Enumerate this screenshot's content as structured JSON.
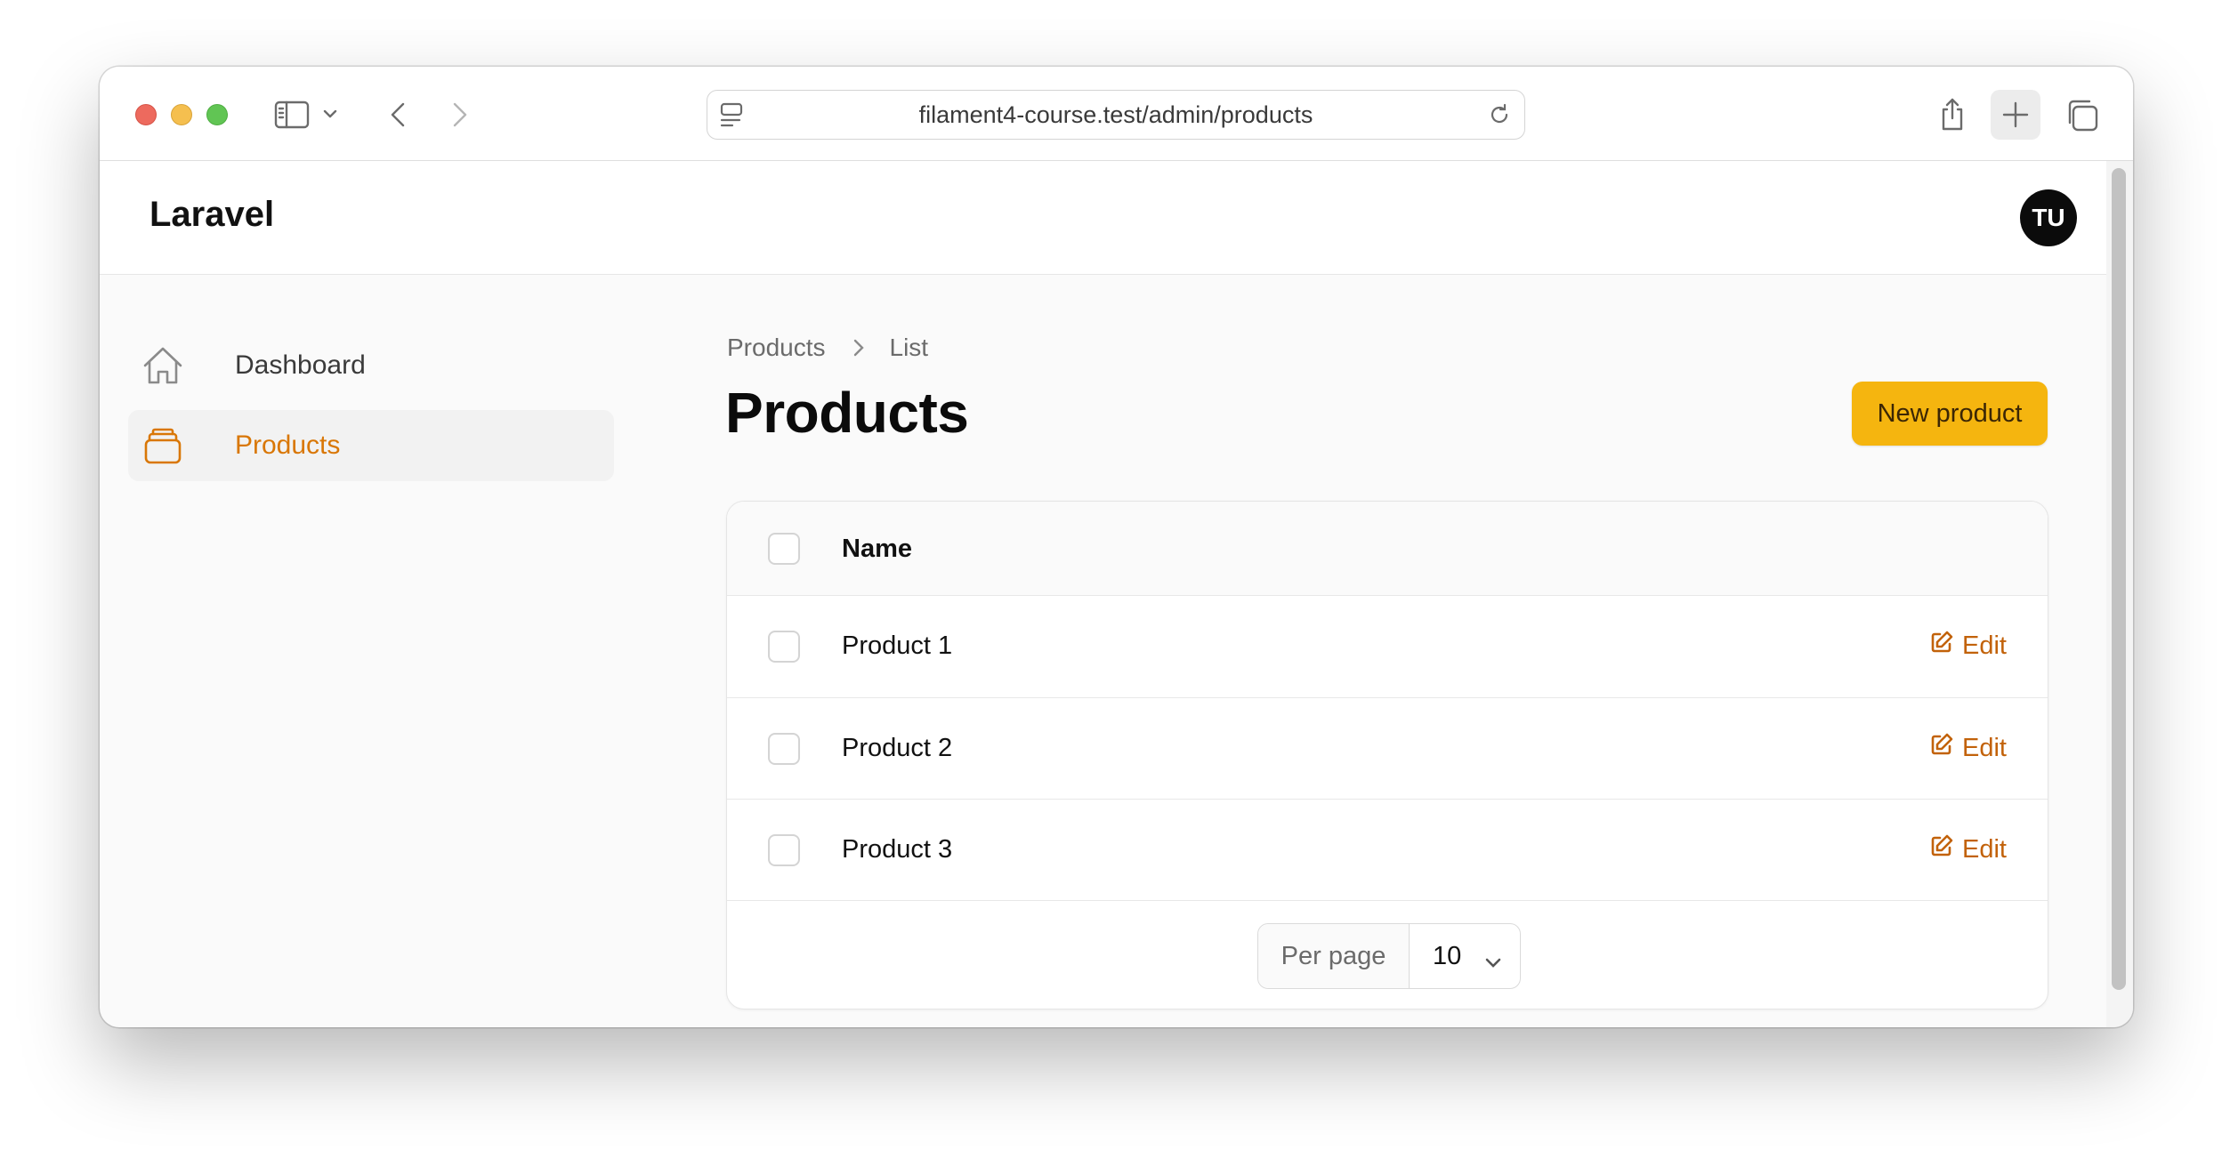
{
  "browser": {
    "url": "filament4-course.test/admin/products"
  },
  "app": {
    "brand": "Laravel",
    "user_initials": "TU"
  },
  "sidebar": {
    "items": [
      {
        "label": "Dashboard",
        "icon": "home-icon",
        "active": false
      },
      {
        "label": "Products",
        "icon": "archive-box-icon",
        "active": true
      }
    ]
  },
  "main": {
    "breadcrumb": [
      "Products",
      "List"
    ],
    "title": "Products",
    "new_button_label": "New product",
    "table": {
      "columns": [
        "Name"
      ],
      "rows": [
        {
          "name": "Product 1",
          "action": "Edit"
        },
        {
          "name": "Product 2",
          "action": "Edit"
        },
        {
          "name": "Product 3",
          "action": "Edit"
        }
      ]
    },
    "pagination": {
      "per_page_label": "Per page",
      "per_page_value": "10"
    }
  },
  "colors": {
    "accent": "#d97706",
    "primary_button": "#f5b50f",
    "edit_link": "#c2620a"
  }
}
